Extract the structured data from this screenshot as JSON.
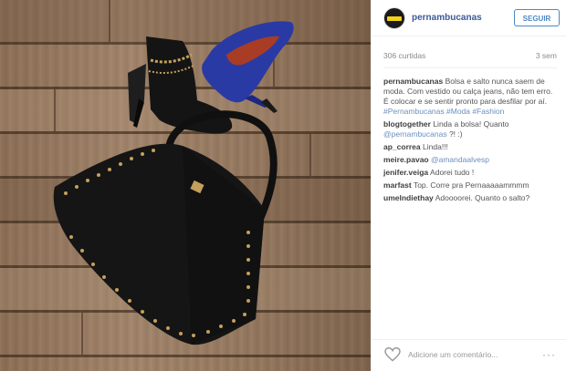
{
  "post": {
    "username": "pernambucanas",
    "follow_label": "SEGUIR",
    "likes": "306 curtidas",
    "time": "3 sem"
  },
  "comments": [
    {
      "user": "pernambucanas",
      "parts": [
        {
          "t": "Bolsa e salto nunca saem de moda. Com vestido ou calça jeans, não tem erro. É colocar e se sentir pronto para desfilar por aí. ",
          "link": false
        },
        {
          "t": "#Pernambucanas",
          "link": true
        },
        {
          "t": " ",
          "link": false
        },
        {
          "t": "#Moda",
          "link": true
        },
        {
          "t": " ",
          "link": false
        },
        {
          "t": "#Fashion",
          "link": true
        }
      ]
    },
    {
      "user": "blogtogether",
      "parts": [
        {
          "t": "Linda a bolsa! Quanto ",
          "link": false
        },
        {
          "t": "@pernambucanas",
          "link": true
        },
        {
          "t": " ?! :)",
          "link": false
        }
      ]
    },
    {
      "user": "ap_correa",
      "parts": [
        {
          "t": "Linda!!!",
          "link": false
        }
      ]
    },
    {
      "user": "meire.pavao",
      "parts": [
        {
          "t": "@amandaalvesp",
          "link": true
        }
      ]
    },
    {
      "user": "jenifer.veiga",
      "parts": [
        {
          "t": "Adorei tudo !",
          "link": false
        }
      ]
    },
    {
      "user": "marfast",
      "parts": [
        {
          "t": "Top. Corre pra Pernaaaaammmm",
          "link": false
        }
      ]
    },
    {
      "user": "umelndiethay",
      "parts": [
        {
          "t": "Adoooorei. Quanto o salto?",
          "link": false
        }
      ]
    }
  ],
  "footer": {
    "add_comment_placeholder": "Adicione um comentário...",
    "more": "···"
  },
  "photo": {
    "description_icons": [
      "black-studded-handbag",
      "black-ankle-boot",
      "blue-pump-heel"
    ],
    "colors": {
      "wood": "#9a7c62",
      "bag": "#151515",
      "pump": "#2a3aa5",
      "studs": "#c4a05a"
    }
  }
}
